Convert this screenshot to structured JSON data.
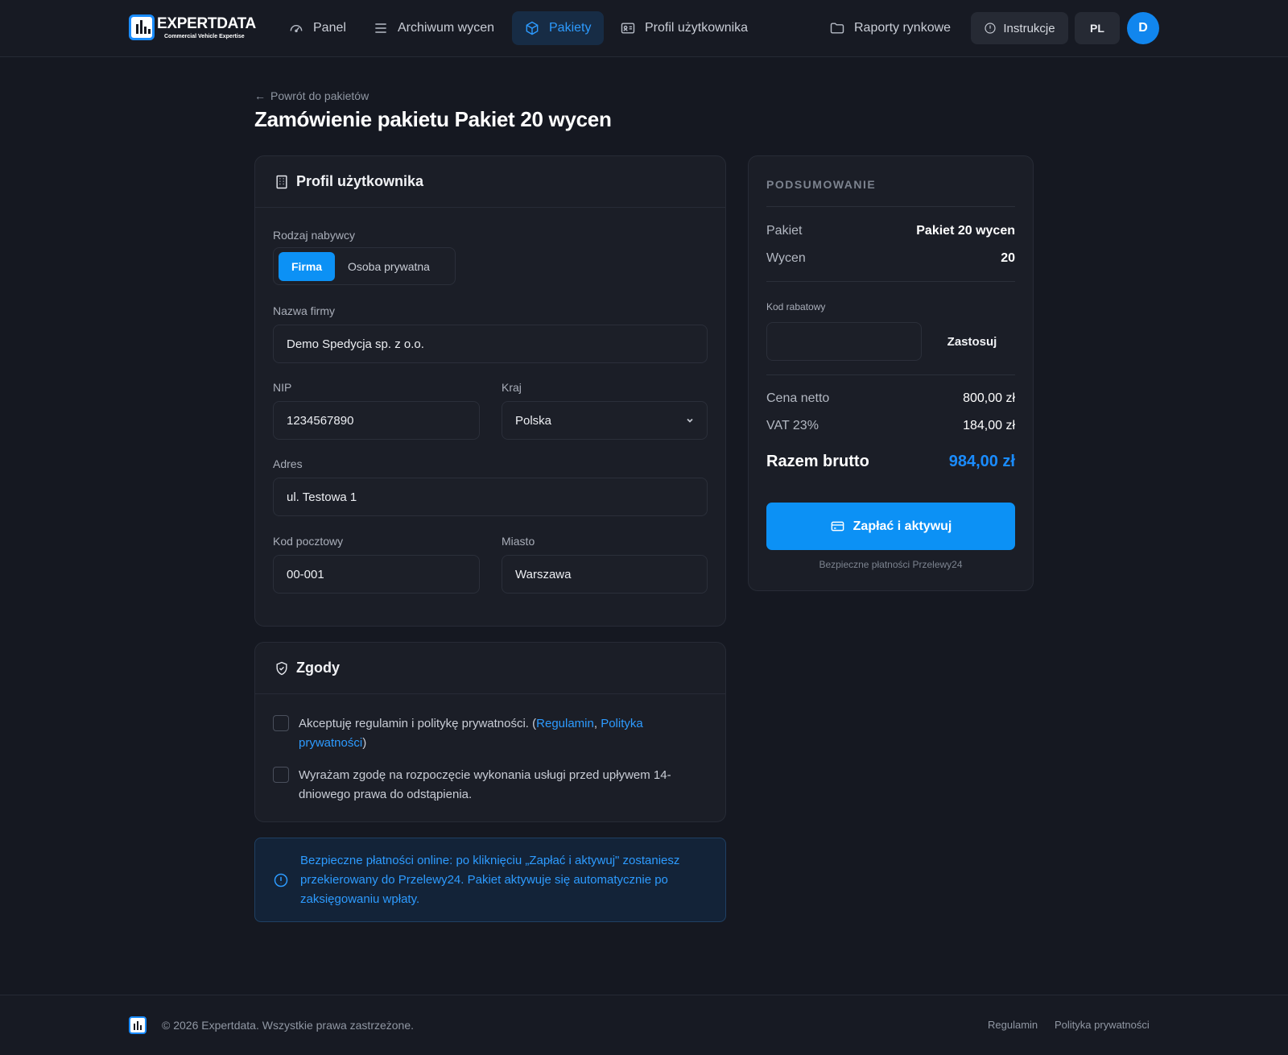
{
  "brand": {
    "name": "EXPERTDATA",
    "tagline": "Commercial Vehicle Expertise",
    "brand_color": "#1a8cff"
  },
  "nav": {
    "items": [
      {
        "label": "Panel",
        "icon": "gauge-icon",
        "active": false
      },
      {
        "label": "Archiwum wycen",
        "icon": "list-icon",
        "active": false
      },
      {
        "label": "Pakiety",
        "icon": "box-icon",
        "active": true
      },
      {
        "label": "Profil użytkownika",
        "icon": "id-card-icon",
        "active": false
      }
    ],
    "reports": {
      "label": "Raporty rynkowe",
      "icon": "folder-icon"
    },
    "instructions": {
      "label": "Instrukcje",
      "icon": "info-circle-icon"
    },
    "language": "PL",
    "avatar_initial": "D"
  },
  "header": {
    "back_link": "Powrót do pakietów",
    "title": "Zamówienie pakietu Pakiet 20 wycen"
  },
  "profile_card": {
    "title": "Profil użytkownika",
    "icon": "building-icon",
    "buyer_type": {
      "label": "Rodzaj nabywcy",
      "options": [
        "Firma",
        "Osoba prywatna"
      ],
      "selected": "Firma"
    },
    "company": {
      "label": "Nazwa firmy",
      "value": "Demo Spedycja sp. z o.o."
    },
    "nip": {
      "label": "NIP",
      "value": "1234567890"
    },
    "country": {
      "label": "Kraj",
      "value": "Polska"
    },
    "address": {
      "label": "Adres",
      "value": "ul. Testowa 1"
    },
    "postal_code": {
      "label": "Kod pocztowy",
      "value": "00-001"
    },
    "city": {
      "label": "Miasto",
      "value": "Warszawa"
    }
  },
  "consents_card": {
    "title": "Zgody",
    "icon": "shield-check-icon",
    "terms": {
      "text_before": "Akceptuję regulamin i politykę prywatności. (",
      "link_terms": "Regulamin",
      "separator": ", ",
      "link_privacy": "Polityka prywatności",
      "text_after": ")",
      "checked": false
    },
    "early_start": {
      "text": "Wyrażam zgodę na rozpoczęcie wykonania usługi przed upływem 14-dniowego prawa do odstąpienia.",
      "checked": false
    }
  },
  "info_box": {
    "text": "Bezpieczne płatności online: po kliknięciu „Zapłać i aktywuj\" zostaniesz przekierowany do Przelewy24. Pakiet aktywuje się automatycznie po zaksięgowaniu wpłaty.",
    "color": "#2d9bff"
  },
  "summary": {
    "heading": "PODSUMOWANIE",
    "package_label": "Pakiet",
    "package_value": "Pakiet 20 wycen",
    "count_label": "Wycen",
    "count_value": "20",
    "discount_label": "Kod rabatowy",
    "discount_value": "",
    "apply_label": "Zastosuj",
    "net_label": "Cena netto",
    "net_value": "800,00 zł",
    "vat_label": "VAT 23%",
    "vat_value": "184,00 zł",
    "total_label": "Razem brutto",
    "total_value": "984,00 zł",
    "pay_button": "Zapłać i aktywuj",
    "pay_icon": "credit-card-icon",
    "secure_note": "Bezpieczne płatności Przelewy24",
    "accent_color": "#0c91f5"
  },
  "footer": {
    "copyright": "© 2026 Expertdata. Wszystkie prawa zastrzeżone.",
    "links": [
      "Regulamin",
      "Polityka prywatności"
    ]
  }
}
